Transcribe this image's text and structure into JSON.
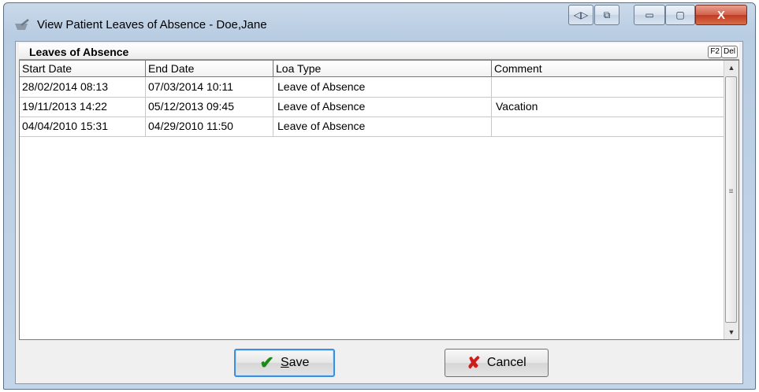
{
  "window": {
    "title": "View Patient Leaves of Absence - Doe,Jane",
    "controls": {
      "nav": "◁▷",
      "restore_alt": "⧉",
      "minimize": "▭",
      "maximize": "▢",
      "close": "X"
    }
  },
  "section": {
    "title": "Leaves of Absence",
    "key_f2": "F2",
    "key_del": "Del"
  },
  "grid": {
    "columns": [
      "Start Date",
      "End Date",
      "Loa Type",
      "Comment"
    ],
    "rows": [
      [
        "28/02/2014 08:13",
        "07/03/2014 10:11",
        "Leave of Absence",
        ""
      ],
      [
        "19/11/2013 14:22",
        "05/12/2013 09:45",
        "Leave of Absence",
        "Vacation"
      ],
      [
        "04/04/2010 15:31",
        "04/29/2010 11:50",
        "Leave of Absence",
        ""
      ]
    ]
  },
  "scrollbar": {
    "up": "▲",
    "down": "▼",
    "grip": "≡"
  },
  "buttons": {
    "save_label_rest": "ave",
    "save_mnemonic": "S",
    "cancel_label": "Cancel"
  },
  "colors": {
    "accent": "#3b8ee0",
    "close_red": "#c13b22",
    "check_green": "#1d8a18",
    "cancel_red": "#cc1c1c"
  }
}
